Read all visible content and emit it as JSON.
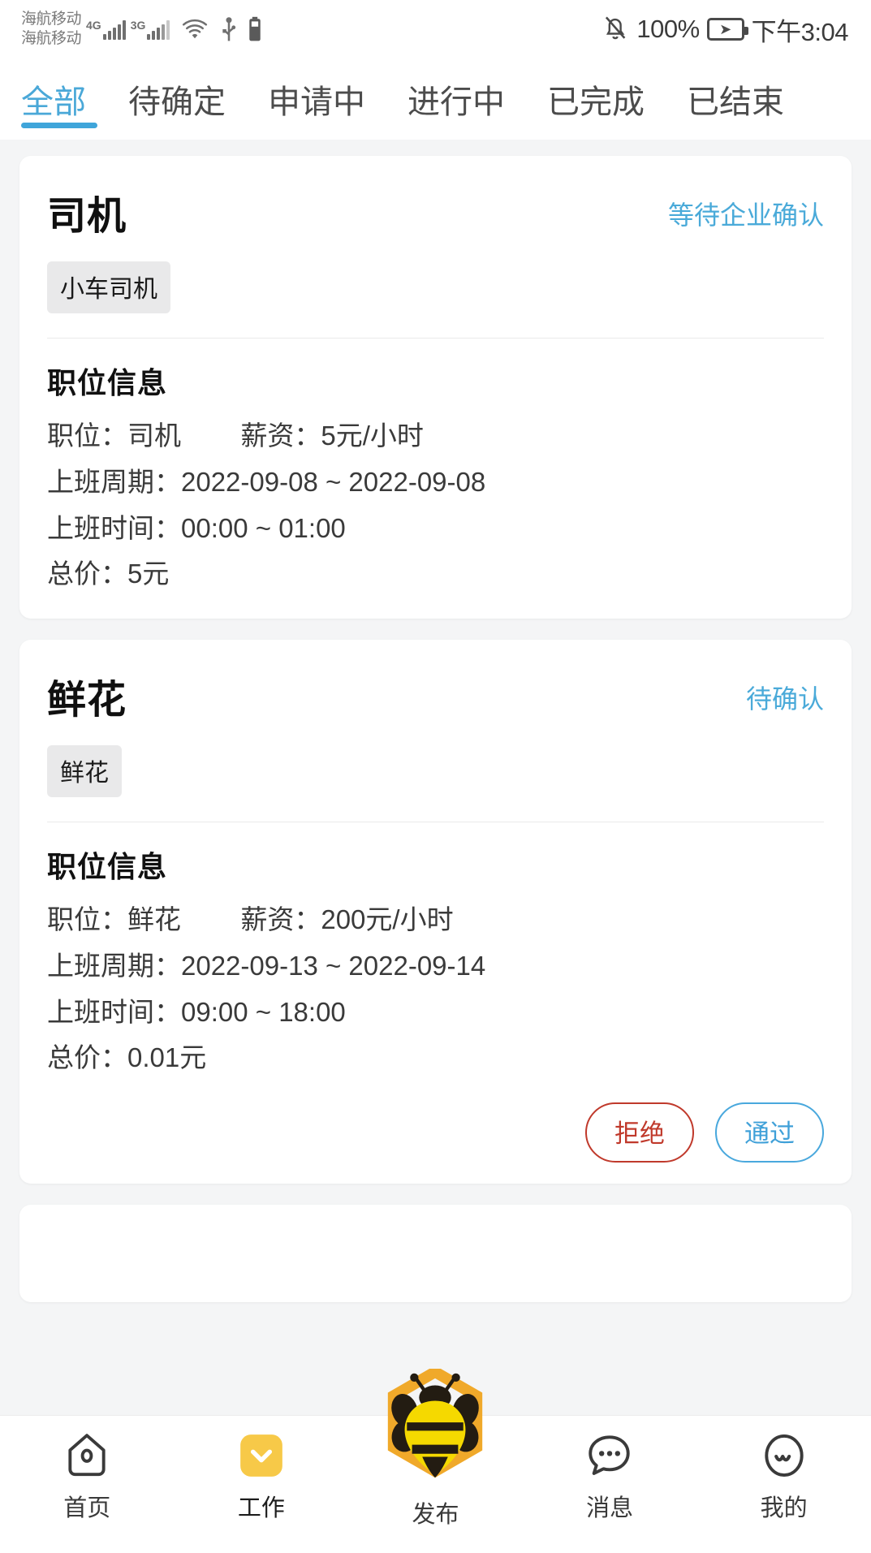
{
  "status_bar": {
    "carrier_line1": "海航移动",
    "carrier_line2": "海航移动",
    "net1": "4G",
    "net2": "3G",
    "wifi_icon": "wifi-icon",
    "usb_icon": "usb-icon",
    "battery_small_icon": "battery-icon",
    "mute_icon": "bell-muted-icon",
    "battery_percent": "100%",
    "charging_icon": "battery-charging-icon",
    "time": "下午3:04"
  },
  "tabs": {
    "items": [
      {
        "label": "全部",
        "active": true
      },
      {
        "label": "待确定",
        "active": false
      },
      {
        "label": "申请中",
        "active": false
      },
      {
        "label": "进行中",
        "active": false
      },
      {
        "label": "已完成",
        "active": false
      },
      {
        "label": "已结束",
        "active": false
      }
    ],
    "active_color": "#3fa5da"
  },
  "cards": [
    {
      "title": "司机",
      "status": "等待企业确认",
      "status_color": "#4aaad9",
      "tag": "小车司机",
      "section_title": "职位信息",
      "lines": [
        "职位：司机        薪资：5元/小时",
        "上班周期：2022-09-08 ~ 2022-09-08",
        "上班时间：00:00 ~ 01:00",
        "总价：5元"
      ],
      "buttons": []
    },
    {
      "title": "鲜花",
      "status": "待确认",
      "status_color": "#4aaad9",
      "tag": "鲜花",
      "section_title": "职位信息",
      "lines": [
        "职位：鲜花        薪资：200元/小时",
        "上班周期：2022-09-13 ~ 2022-09-14",
        "上班时间：09:00 ~ 18:00",
        "总价：0.01元"
      ],
      "buttons": [
        {
          "label": "拒绝",
          "kind": "reject",
          "color": "#c0392b"
        },
        {
          "label": "通过",
          "kind": "accept",
          "color": "#49a8dd"
        }
      ]
    }
  ],
  "bottom_nav": {
    "items": [
      {
        "label": "首页",
        "icon": "home-icon",
        "active": false
      },
      {
        "label": "工作",
        "icon": "work-chevron-icon",
        "active": true
      },
      {
        "label": "发布",
        "icon": "bee-publish-icon",
        "active": false
      },
      {
        "label": "消息",
        "icon": "message-bubble-icon",
        "active": false
      },
      {
        "label": "我的",
        "icon": "profile-icon",
        "active": false
      }
    ],
    "active_color": "#f5c33b"
  }
}
